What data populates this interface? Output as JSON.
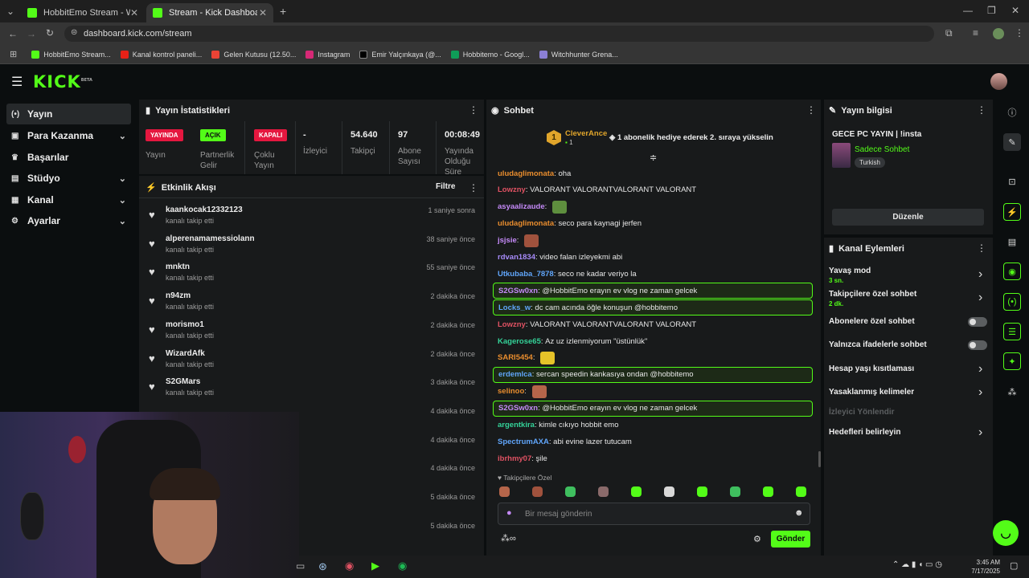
{
  "browser": {
    "tabs": [
      {
        "title": "HobbitEmo Stream - Watch Live"
      },
      {
        "title": "Stream - Kick Dashboard"
      }
    ],
    "url": "dashboard.kick.com/stream",
    "bookmarks": [
      "HobbitEmo Stream...",
      "Kanal kontrol paneli...",
      "Gelen Kutusu (12.50...",
      "Instagram",
      "Emir Yalçınkaya (@...",
      "Hobbitemo - Googl...",
      "Witchhunter Grena..."
    ]
  },
  "header": {
    "logo": "KICK",
    "logo_badge": "BETA"
  },
  "sidebar": {
    "items": [
      {
        "label": "Yayın",
        "icon": "broadcast-icon"
      },
      {
        "label": "Para Kazanma",
        "icon": "money-icon"
      },
      {
        "label": "Başarılar",
        "icon": "trophy-icon"
      },
      {
        "label": "Stüdyo",
        "icon": "studio-icon"
      },
      {
        "label": "Kanal",
        "icon": "channel-icon"
      },
      {
        "label": "Ayarlar",
        "icon": "gear-icon"
      }
    ]
  },
  "stats": {
    "title": "Yayın İstatistikleri",
    "cells": [
      {
        "badge": "YAYINDA",
        "label": "Yayın"
      },
      {
        "badge": "AÇIK",
        "label": "Partnerlik Gelir"
      },
      {
        "badge": "KAPALI",
        "label": "Çoklu Yayın"
      },
      {
        "value": "-",
        "label": "İzleyici"
      },
      {
        "value": "54.640",
        "label": "Takipçi"
      },
      {
        "value": "97",
        "label": "Abone Sayısı"
      },
      {
        "value": "00:08:49",
        "label": "Yayında Olduğu Süre"
      }
    ]
  },
  "activity": {
    "title": "Etkinlik Akışı",
    "filter": "Filtre",
    "items": [
      {
        "name": "kaankocak12332123",
        "action": "kanalı takip etti",
        "time": "1 saniye sonra"
      },
      {
        "name": "alperenamamessiolann",
        "action": "kanalı takip etti",
        "time": "38 saniye önce"
      },
      {
        "name": "mnktn",
        "action": "kanalı takip etti",
        "time": "55 saniye önce"
      },
      {
        "name": "n94zm",
        "action": "kanalı takip etti",
        "time": "2 dakika önce"
      },
      {
        "name": "morismo1",
        "action": "kanalı takip etti",
        "time": "2 dakika önce"
      },
      {
        "name": "WizardAfk",
        "action": "kanalı takip etti",
        "time": "2 dakika önce"
      },
      {
        "name": "S2GMars",
        "action": "kanalı takip etti",
        "time": "3 dakika önce"
      },
      {
        "name": "",
        "action": "",
        "time": "4 dakika önce"
      },
      {
        "name": "",
        "action": "",
        "time": "4 dakika önce"
      },
      {
        "name": "",
        "action": "",
        "time": "4 dakika önce"
      },
      {
        "name": "",
        "action": "",
        "time": "5 dakika önce"
      },
      {
        "name": "",
        "action": "",
        "time": "5 dakika önce"
      }
    ]
  },
  "chat": {
    "title": "Sohbet",
    "pinned_user": "CleverAnce",
    "pinned_rank": "1",
    "pinned_count": "1",
    "pinned_text": "1 abonelik hediye ederek 2. sıraya yükselin",
    "messages": [
      {
        "user": "uludaglimonata",
        "color": "#e98d2e",
        "text": "oha",
        "hl": false
      },
      {
        "user": "Lowzny",
        "color": "#e05263",
        "text": "VALORANT VALORANTVALORANT VALORANT",
        "hl": false
      },
      {
        "user": "asyaalizaude",
        "color": "#c58af9",
        "text": "",
        "hl": false,
        "emote": "#5e8f3e"
      },
      {
        "user": "uludaglimonata",
        "color": "#e98d2e",
        "text": "seco para kaynagi jerfen",
        "hl": false
      },
      {
        "user": "jsjsie",
        "color": "#c58af9",
        "text": "",
        "hl": false,
        "emote": "#a0523d"
      },
      {
        "user": "rdvan1834",
        "color": "#a78bfa",
        "text": "video falan izleyekmi abi",
        "hl": false
      },
      {
        "user": "Utkubaba_7878",
        "color": "#60a5fa",
        "text": "seco ne kadar veriyo la",
        "hl": false
      },
      {
        "user": "S2GSw0xn",
        "color": "#c58af9",
        "text": "@HobbitEmo erayın ev vlog ne zaman gelcek",
        "hl": true
      },
      {
        "user": "Locks_w",
        "color": "#60a5fa",
        "text": "dc cam acında öğle konuşun @hobbitemo",
        "hl": true
      },
      {
        "user": "Lowzny",
        "color": "#e05263",
        "text": "VALORANT VALORANTVALORANT VALORANT",
        "hl": false
      },
      {
        "user": "Kagerose65",
        "color": "#34d399",
        "text": "Az uz izlenmiyorum \"üstünlük\"",
        "hl": false
      },
      {
        "user": "SARI5454",
        "color": "#e98d2e",
        "text": "",
        "hl": false,
        "emote": "#e6c229"
      },
      {
        "user": "erdemlca",
        "color": "#60a5fa",
        "text": "sercan speedin kankasıya ondan @hobbitemo",
        "hl": true
      },
      {
        "user": "selinoo",
        "color": "#e98d2e",
        "text": "",
        "hl": false,
        "emote": "#b5654a"
      },
      {
        "user": "S2GSw0xn",
        "color": "#c58af9",
        "text": "@HobbitEmo erayın ev vlog ne zaman gelcek",
        "hl": true
      },
      {
        "user": "argentkira",
        "color": "#34d399",
        "text": "kimle cıkıyo hobbit emo",
        "hl": false
      },
      {
        "user": "SpectrumAXA",
        "color": "#60a5fa",
        "text": "abi evine lazer tutucam",
        "hl": false
      },
      {
        "user": "ibrhmy07",
        "color": "#e05263",
        "text": "şile",
        "hl": false
      }
    ],
    "followers_only": "Takipçilere Özel",
    "input_placeholder": "Bir mesaj gönderin",
    "send_label": "Gönder"
  },
  "stream_info": {
    "title": "Yayın bilgisi",
    "stream_title": "GECE PC YAYIN | !insta",
    "category": "Sadece Sohbet",
    "tag": "Turkish",
    "edit_label": "Düzenle"
  },
  "channel_actions": {
    "title": "Kanal Eylemleri",
    "items": [
      {
        "label": "Yavaş mod",
        "sub": "3 sn.",
        "kind": "chevron"
      },
      {
        "label": "Takipçilere özel sohbet",
        "sub": "2 dk.",
        "kind": "chevron"
      },
      {
        "label": "Abonelere özel sohbet",
        "sub": "",
        "kind": "toggle"
      },
      {
        "label": "Yalnızca ifadelerle sohbet",
        "sub": "",
        "kind": "toggle"
      },
      {
        "label": "Hesap yaşı kısıtlaması",
        "sub": "",
        "kind": "chevron"
      },
      {
        "label": "Yasaklanmış kelimeler",
        "sub": "",
        "kind": "chevron"
      },
      {
        "label": "İzleyici Yönlendir",
        "sub": "",
        "kind": "disabled"
      },
      {
        "label": "Hedefleri belirleyin",
        "sub": "",
        "kind": "chevron"
      }
    ]
  },
  "taskbar": {
    "time": "3:45 AM",
    "date": "7/17/2025"
  },
  "colors": {
    "accent": "#53fc18",
    "live": "#e5173f",
    "bg": "#0b0e0f",
    "panel": "#181a1b"
  }
}
